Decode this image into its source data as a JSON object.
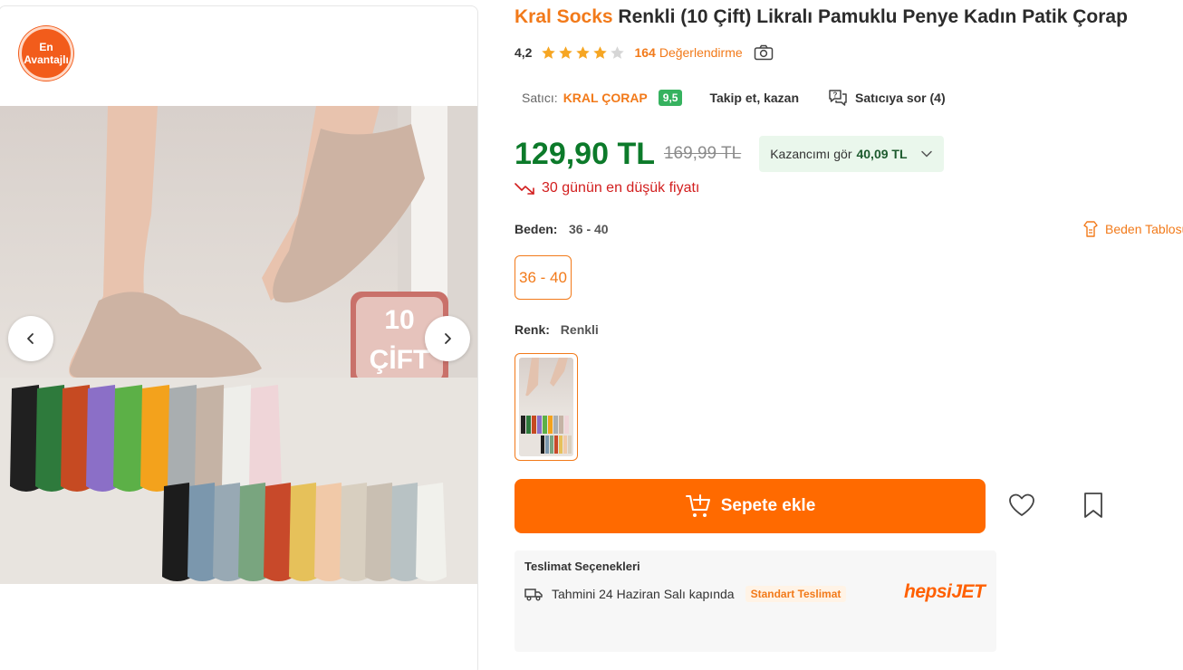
{
  "gallery": {
    "badge_line1": "En",
    "badge_line2": "Avantajlı",
    "photo_overlay_line1": "10",
    "photo_overlay_line2": "ÇİFT"
  },
  "product": {
    "brand": "Kral Socks",
    "title": "Renkli (10 Çift) Likralı Pamuklu Penye Kadın Patik Çorap",
    "rating": "4,2",
    "rating_stars": 4.2,
    "review_count": "164",
    "review_label": "Değerlendirme"
  },
  "seller": {
    "label": "Satıcı:",
    "name": "KRAL ÇORAP",
    "score": "9,5",
    "follow": "Takip et, kazan",
    "ask": "Satıcıya sor (4)"
  },
  "price": {
    "current": "129,90 TL",
    "old": "169,99 TL",
    "earn_label": "Kazancımı gör",
    "earn_value": "40,09 TL",
    "lowest_note": "30 günün en düşük fiyatı"
  },
  "size": {
    "label": "Beden:",
    "selected": "36 - 40",
    "table_link": "Beden Tablosu",
    "options": [
      "36 - 40"
    ]
  },
  "color": {
    "label": "Renk:",
    "selected": "Renkli"
  },
  "actions": {
    "add_to_cart": "Sepete ekle"
  },
  "delivery": {
    "title": "Teslimat Seçenekleri",
    "estimate": "Tahmini 24 Haziran Salı kapında",
    "type": "Standart Teslimat",
    "carrier_a": "hepsi",
    "carrier_b": "JET"
  },
  "colors": {
    "brand_orange": "#f27a1a",
    "price_green": "#0c7a2a",
    "cart_orange": "#ff6a00",
    "alert_red": "#d21e1e",
    "seller_badge_green": "#36b25f"
  }
}
